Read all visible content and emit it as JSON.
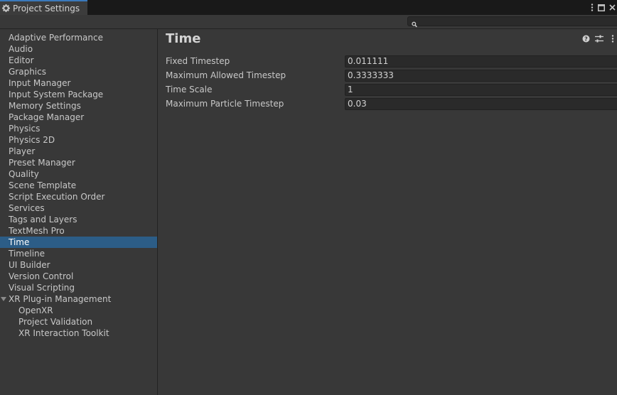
{
  "window": {
    "title": "Project Settings",
    "controls": [
      "more-icon",
      "maximize-icon",
      "close-icon"
    ]
  },
  "search": {
    "placeholder": "",
    "value": ""
  },
  "sidebar": {
    "items": [
      {
        "label": "Adaptive Performance"
      },
      {
        "label": "Audio"
      },
      {
        "label": "Editor"
      },
      {
        "label": "Graphics"
      },
      {
        "label": "Input Manager"
      },
      {
        "label": "Input System Package"
      },
      {
        "label": "Memory Settings"
      },
      {
        "label": "Package Manager"
      },
      {
        "label": "Physics"
      },
      {
        "label": "Physics 2D"
      },
      {
        "label": "Player"
      },
      {
        "label": "Preset Manager"
      },
      {
        "label": "Quality"
      },
      {
        "label": "Scene Template"
      },
      {
        "label": "Script Execution Order"
      },
      {
        "label": "Services"
      },
      {
        "label": "Tags and Layers"
      },
      {
        "label": "TextMesh Pro"
      },
      {
        "label": "Time",
        "selected": true
      },
      {
        "label": "Timeline"
      },
      {
        "label": "UI Builder"
      },
      {
        "label": "Version Control"
      },
      {
        "label": "Visual Scripting"
      },
      {
        "label": "XR Plug-in Management",
        "expanded": true
      },
      {
        "label": "OpenXR",
        "child": true
      },
      {
        "label": "Project Validation",
        "child": true
      },
      {
        "label": "XR Interaction Toolkit",
        "child": true
      }
    ]
  },
  "main": {
    "title": "Time",
    "header_icons": [
      "help-icon",
      "preset-icon",
      "more-icon"
    ],
    "properties": [
      {
        "label": "Fixed Timestep",
        "value": "0.011111"
      },
      {
        "label": "Maximum Allowed Timestep",
        "value": "0.3333333"
      },
      {
        "label": "Time Scale",
        "value": "1"
      },
      {
        "label": "Maximum Particle Timestep",
        "value": "0.03"
      }
    ]
  },
  "colors": {
    "background": "#383838",
    "tabbar": "#191919",
    "selection": "#2c5d87",
    "accent": "#3a79bb",
    "field": "#2a2a2a"
  }
}
